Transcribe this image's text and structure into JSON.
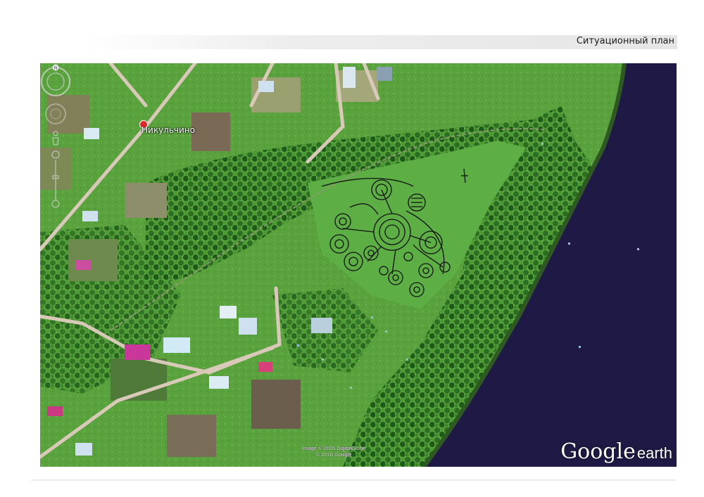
{
  "header": {
    "title": "Ситуационный план"
  },
  "map": {
    "place_label": "Никульчино",
    "imagery_credit": [
      "Image © 2016 DigitalGlobe",
      "© 2016 Google"
    ],
    "brand": {
      "google": "Google",
      "earth": "earth"
    },
    "compass_letter": "N"
  },
  "colors": {
    "vegetation": "#3f8a2f",
    "forest": "#1f5d1a",
    "river": "#1e1a45",
    "road": "#d9c9b8",
    "overlay_lines": "#111111",
    "pin": "#e0262b"
  },
  "icons": [
    "place-pin-icon",
    "compass-ring-icon",
    "tilt-ring-icon",
    "zoom-slider-icon",
    "pegman-icon"
  ]
}
